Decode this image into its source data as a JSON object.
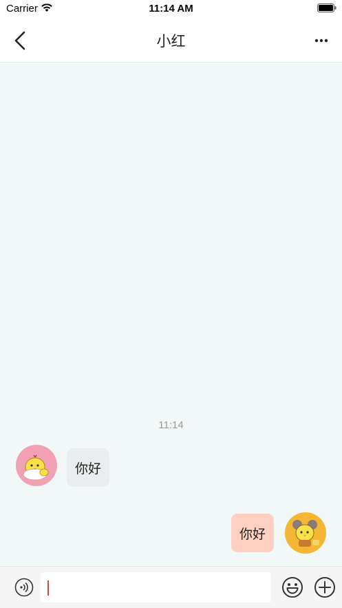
{
  "status_bar": {
    "carrier": "Carrier",
    "time": "11:14 AM",
    "icons": [
      "wifi-icon",
      "battery-icon"
    ]
  },
  "nav": {
    "title": "小红",
    "back_icon": "chevron-left-icon",
    "more_icon": "more-horizontal-icon"
  },
  "chat": {
    "timestamp": "11:14",
    "messages": [
      {
        "side": "left",
        "text": "你好",
        "avatar": "chick-avatar-pink"
      },
      {
        "side": "right",
        "text": "你好",
        "avatar": "chick-avatar-orange"
      }
    ]
  },
  "input_bar": {
    "message_value": "",
    "icons": [
      "voice-icon",
      "emoji-icon",
      "plus-circle-icon"
    ]
  },
  "colors": {
    "chat_background": "#f2f7f7",
    "incoming_bubble": "#eaeded",
    "outgoing_bubble": "#ffd0bf",
    "cursor": "#e0433b"
  }
}
